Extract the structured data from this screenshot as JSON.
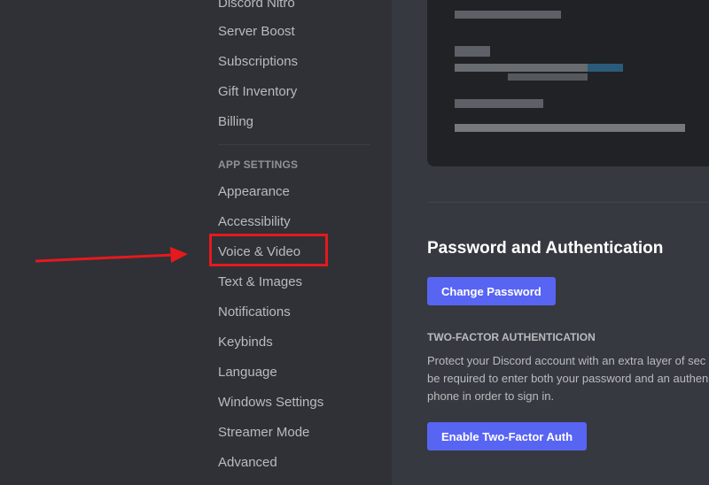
{
  "sidebar": {
    "billing_items": [
      {
        "label": "Discord Nitro"
      },
      {
        "label": "Server Boost"
      },
      {
        "label": "Subscriptions"
      },
      {
        "label": "Gift Inventory"
      },
      {
        "label": "Billing"
      }
    ],
    "app_settings_header": "APP SETTINGS",
    "app_items": [
      {
        "label": "Appearance"
      },
      {
        "label": "Accessibility"
      },
      {
        "label": "Voice & Video"
      },
      {
        "label": "Text & Images"
      },
      {
        "label": "Notifications"
      },
      {
        "label": "Keybinds"
      },
      {
        "label": "Language"
      },
      {
        "label": "Windows Settings"
      },
      {
        "label": "Streamer Mode"
      },
      {
        "label": "Advanced"
      }
    ]
  },
  "main": {
    "password_section": {
      "title": "Password and Authentication",
      "change_password_label": "Change Password"
    },
    "two_factor": {
      "header": "TWO-FACTOR AUTHENTICATION",
      "description_lines": [
        "Protect your Discord account with an extra layer of sec",
        "be required to enter both your password and an authen",
        "phone in order to sign in."
      ],
      "enable_label": "Enable Two-Factor Auth"
    }
  },
  "annotation": {
    "highlight_color": "#e6191e",
    "highlighted_item": "Voice & Video"
  },
  "colors": {
    "sidebar_bg": "#2f3136",
    "content_bg": "#36393f",
    "brand": "#5865f2",
    "text_muted": "#b9bbbe"
  }
}
